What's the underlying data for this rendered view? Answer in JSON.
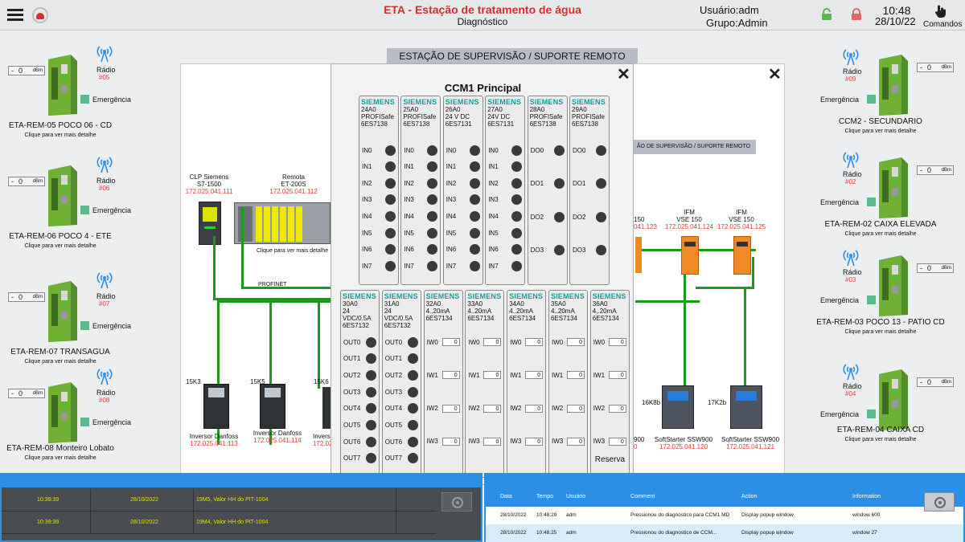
{
  "header": {
    "title": "ETA - Estação de tratamento de água",
    "subtitle": "Diagnóstico",
    "user": "Usuário:adm",
    "group": "Grupo:Admin",
    "time": "10:48",
    "date": "28/10/22",
    "commands": "Comandos"
  },
  "background_title": "ESTAÇÃO DE SUPERVISÃO / SUPORTE REMOTO",
  "background_title_small": "ÃO DE SUPERVISÃO / SUPORTE REMOTO",
  "left_stations": [
    {
      "dbm_val": "0",
      "dbm_unit": "dBm",
      "sign": "-",
      "radio": "Rádio",
      "num": "#05",
      "emerg": "Emergência",
      "name": "ETA-REM-05 POCO 06 - CD",
      "hint": "Clique para ver mais detalhe"
    },
    {
      "dbm_val": "0",
      "dbm_unit": "dBm",
      "sign": "-",
      "radio": "Rádio",
      "num": "#06",
      "emerg": "Emergência",
      "name": "ETA-REM-06 POCO 4 - ETE",
      "hint": "Clique para ver mais detalhe"
    },
    {
      "dbm_val": "0",
      "dbm_unit": "dBm",
      "sign": "-",
      "radio": "Rádio",
      "num": "#07",
      "emerg": "Emergência",
      "name": "ETA-REM-07 TRANSAGUA",
      "hint": "Clique para ver mais detalhe"
    },
    {
      "dbm_val": "0",
      "dbm_unit": "dBm",
      "sign": "-",
      "radio": "Rádio",
      "num": "#08",
      "emerg": "Emergência",
      "name": "ETA-REM-08 Monteiro Lobato",
      "hint": "Clique para ver mais detalhe"
    }
  ],
  "right_stations": [
    {
      "dbm_val": "0",
      "dbm_unit": "dBm",
      "sign": "-",
      "radio": "Rádio",
      "num": "#09",
      "emerg": "Emergência",
      "name": "CCM2 - SECUNDARIO",
      "hint": "Clique para ver mais detalhe"
    },
    {
      "dbm_val": "0",
      "dbm_unit": "dBm",
      "sign": "-",
      "radio": "Rádio",
      "num": "#02",
      "emerg": "Emergência",
      "name": "ETA-REM-02 CAIXA ELEVADA",
      "hint": "Clique para ver mais detalhe"
    },
    {
      "dbm_val": "0",
      "dbm_unit": "dBm",
      "sign": "-",
      "radio": "Rádio",
      "num": "#03",
      "emerg": "Emergência",
      "name": "ETA-REM-03 POCO 13 - PATIO CD",
      "hint": "Clique para ver mais detalhe"
    },
    {
      "dbm_val": "0",
      "dbm_unit": "dBm",
      "sign": "-",
      "radio": "Rádio",
      "num": "#04",
      "emerg": "Emergência",
      "name": "ETA-REM-04 CAIXA CD",
      "hint": "Clique para ver mais detalhe"
    }
  ],
  "diagram": {
    "clp": {
      "l1": "CLP Siemens",
      "l2": "S7-1500",
      "ip": "172.025.041.111"
    },
    "remota": {
      "l1": "Remota",
      "l2": "ET-200S",
      "ip": "172.025.041.112"
    },
    "remota_hint": "Clique para ver mais detalhe",
    "profinet": "PROFINET",
    "inv1": {
      "tag": "15K3",
      "name": "Inversor Danfoss",
      "ip": "172.025.041.113"
    },
    "inv2": {
      "tag": "15K5",
      "name": "Inversor Danfoss",
      "ip": "172.025.041.114"
    },
    "inv3": {
      "tag": "15K6",
      "name": "Inversor",
      "ip": "172.02"
    },
    "ifm0": {
      "l1": "150",
      "ip": "041.123"
    },
    "ifm1": {
      "l1": "IFM",
      "l2": "VSE 150",
      "ip": "172.025.041.124"
    },
    "ifm2": {
      "l1": "IFM",
      "l2": "VSE 150",
      "ip": "172.025.041.125"
    },
    "ss0": {
      "name": "900",
      "ip": "0"
    },
    "ss1": {
      "tag": "16K8b",
      "name": "SoftStarter SSW900",
      "ip": "172.025.041.120"
    },
    "ss2": {
      "tag": "17K2b",
      "name": "SoftStarter SSW900",
      "ip": "172.025.041.121"
    }
  },
  "ccm": {
    "title": "CCM1 Principal",
    "top_modules": [
      {
        "brand": "SIEMENS",
        "code": "24A0",
        "desc": "PROFISafe",
        "part": "6ES7138",
        "ios": [
          "IN0",
          "IN1",
          "IN2",
          "IN3",
          "IN4",
          "IN5",
          "IN6",
          "IN7"
        ]
      },
      {
        "brand": "SIEMENS",
        "code": "25A0",
        "desc": "PROFISafe",
        "part": "6ES7138",
        "ios": [
          "IN0",
          "IN1",
          "IN2",
          "IN3",
          "IN4",
          "IN5",
          "IN6",
          "IN7"
        ]
      },
      {
        "brand": "SIEMENS",
        "code": "26A0",
        "desc": "24 V DC",
        "part": "6ES7131",
        "ios": [
          "IN0",
          "IN1",
          "IN2",
          "IN3",
          "IN4",
          "IN5",
          "IN6",
          "IN7"
        ]
      },
      {
        "brand": "SIEMENS",
        "code": "27A0",
        "desc": "24V DC",
        "part": "6ES7131",
        "ios": [
          "IN0",
          "IN1",
          "IN2",
          "IN3",
          "IN4",
          "IN5",
          "IN6",
          "IN7"
        ]
      },
      {
        "brand": "SIEMENS",
        "code": "28A0",
        "desc": "PROFISafe",
        "part": "6ES7138",
        "ios": [
          "DO0",
          "DO1",
          "DO2",
          "DO3"
        ]
      },
      {
        "brand": "SIEMENS",
        "code": "29A0",
        "desc": "PROFISafe",
        "part": "6ES7138",
        "ios": [
          "DO0",
          "DO1",
          "DO2",
          "DO3"
        ]
      }
    ],
    "bottom_modules": [
      {
        "brand": "SIEMENS",
        "code": "30A0",
        "desc": "24 VDC/0.5A",
        "part": "6ES7132",
        "type": "out",
        "ios": [
          "OUT0",
          "OUT1",
          "OUT2",
          "OUT3",
          "OUT4",
          "OUT5",
          "OUT6",
          "OUT7"
        ]
      },
      {
        "brand": "SIEMENS",
        "code": "31A0",
        "desc": "24 VDC/0.5A",
        "part": "6ES7132",
        "type": "out",
        "ios": [
          "OUT0",
          "OUT1",
          "OUT2",
          "OUT3",
          "OUT4",
          "OUT5",
          "OUT6",
          "OUT7"
        ]
      },
      {
        "brand": "SIEMENS",
        "code": "32A0",
        "desc": "4..20mA",
        "part": "6ES7134",
        "type": "iw",
        "ios": [
          "IW0",
          "IW1",
          "IW2",
          "IW3"
        ],
        "val": "0"
      },
      {
        "brand": "SIEMENS",
        "code": "33A0",
        "desc": "4..20mA",
        "part": "6ES7134",
        "type": "iw",
        "ios": [
          "IW0",
          "IW1",
          "IW2",
          "IW3"
        ],
        "val": "0"
      },
      {
        "brand": "SIEMENS",
        "code": "34A0",
        "desc": "4..20mA",
        "part": "6ES7134",
        "type": "iw",
        "ios": [
          "IW0",
          "IW1",
          "IW2",
          "IW3"
        ],
        "val": "0"
      },
      {
        "brand": "SIEMENS",
        "code": "35A0",
        "desc": "4..20mA",
        "part": "6ES7134",
        "type": "iw",
        "ios": [
          "IW0",
          "IW1",
          "IW2",
          "IW3"
        ],
        "val": "0"
      },
      {
        "brand": "SIEMENS",
        "code": "36A0",
        "desc": "4..20mA",
        "part": "6ES7134",
        "type": "iw",
        "ios": [
          "IW0",
          "IW1",
          "IW2",
          "IW3"
        ],
        "val": "0",
        "extra": "Reserva"
      }
    ]
  },
  "alarms": [
    {
      "time": "10:39:39",
      "date": "28/10/2022",
      "msg": "19M5, Valor HH do PIT-1004"
    },
    {
      "time": "10:39:39",
      "date": "28/10/2022",
      "msg": "19M4, Valor HH do PIT-1004"
    }
  ],
  "log": {
    "columns": [
      "Data",
      "Tempo",
      "Usuário",
      "Comment",
      "Action",
      "Information"
    ],
    "rows": [
      [
        "28/10/2022",
        "10:48:29",
        "adm",
        "Pressionou do diagnostico para CCM1 MD",
        "Display popup window",
        "window 600"
      ],
      [
        "28/10/2022",
        "10:48:25",
        "adm",
        "Pressionou do diagnostico de CCM...",
        "Display popup window",
        "window 27"
      ]
    ]
  },
  "colors": {
    "accent_red": "#e53935",
    "wire": "#1a9c1a",
    "siemens": "#169d9d",
    "bar_blue": "#1e90e6"
  }
}
